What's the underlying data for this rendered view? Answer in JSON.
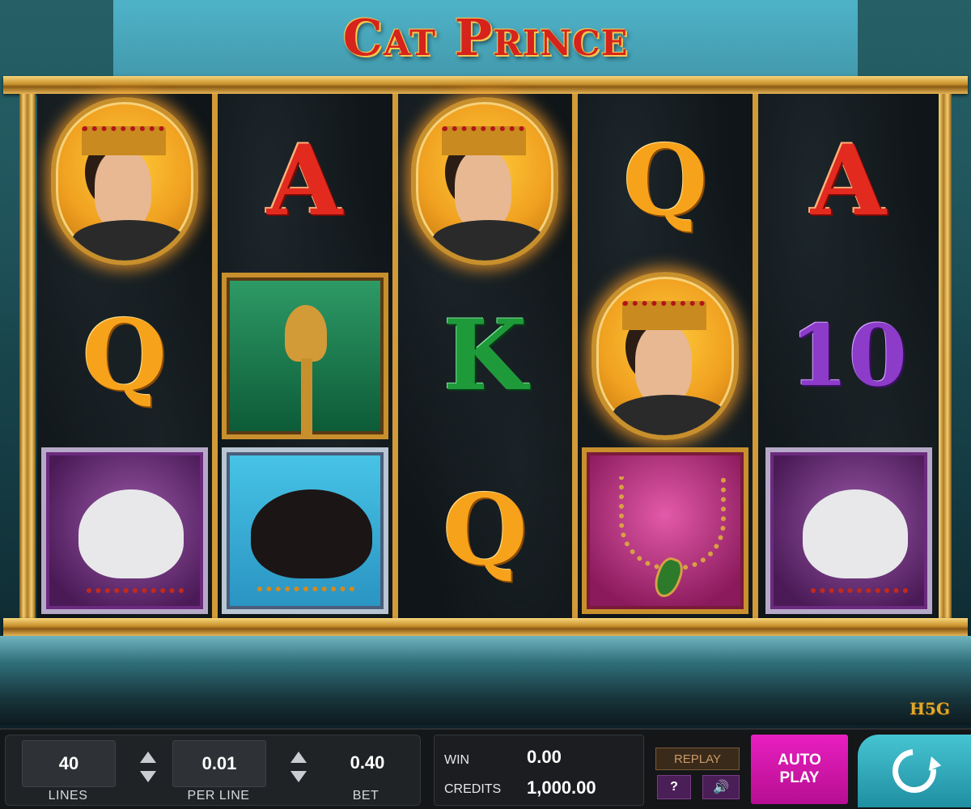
{
  "game": {
    "title": "Cat Prince",
    "studio_logo": "H5G"
  },
  "reels": [
    [
      "prince",
      "Q",
      "snow-leopard"
    ],
    [
      "A",
      "golden-cat-idol",
      "black-panther"
    ],
    [
      "prince",
      "K",
      "Q"
    ],
    [
      "Q",
      "prince",
      "ruby-necklace"
    ],
    [
      "A",
      "10",
      "snow-leopard"
    ]
  ],
  "symbols": {
    "letter_A": "A",
    "letter_Q": "Q",
    "letter_K": "K",
    "number_10": "10"
  },
  "controls": {
    "lines_value": "40",
    "lines_label": "LINES",
    "per_line_value": "0.01",
    "per_line_label": "PER LINE",
    "bet_value": "0.40",
    "bet_label": "BET",
    "win_label": "WIN",
    "win_value": "0.00",
    "credits_label": "CREDITS",
    "credits_value": "1,000.00",
    "replay_label": "REPLAY",
    "help_label": "?",
    "sound_label": "🔊",
    "auto_play_line1": "AUTO",
    "auto_play_line2": "PLAY"
  },
  "colors": {
    "title": "#d6231b",
    "frame_gold": "#c8902d",
    "auto_play": "#d117ab",
    "spin": "#2fb0c0"
  }
}
